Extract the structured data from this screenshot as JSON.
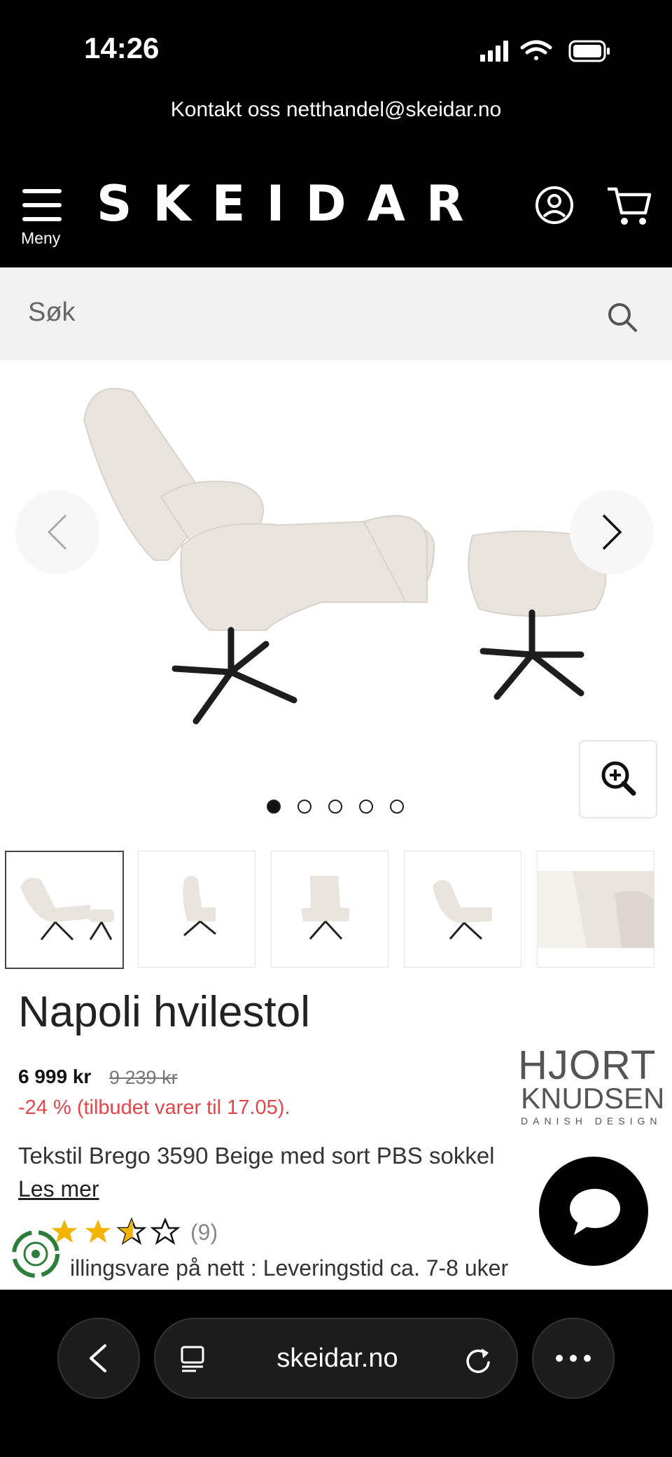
{
  "status_bar": {
    "time": "14:26"
  },
  "header": {
    "contact_text": "Kontakt oss netthandel@skeidar.no",
    "logo_text": "SKEIDAR",
    "menu_label": "Meny"
  },
  "search": {
    "placeholder": "Søk"
  },
  "gallery": {
    "dots_count": 5,
    "active_dot": 0,
    "thumbnails": [
      "thumb-1",
      "thumb-2",
      "thumb-3",
      "thumb-4",
      "thumb-5"
    ]
  },
  "product": {
    "title": "Napoli hvilestol",
    "price": "6 999 kr",
    "old_price": "9 239 kr",
    "discount": "-24 % (tilbudet varer til 17.05).",
    "brand_line1": "HJORT",
    "brand_line2": "KNUDSEN",
    "brand_line3": "DANISH DESIGN",
    "description": "Tekstil Brego 3590 Beige med sort PBS sokkel",
    "read_more": "Les mer",
    "rating": 2.5,
    "rating_max": 5,
    "reviews": "(9)",
    "delivery": "illingsvare på nett : Leveringstid ca. 7-8 uker"
  },
  "browser": {
    "url": "skeidar.no"
  },
  "colors": {
    "discount": "#e0464a",
    "accent_star": "#f5b400"
  }
}
